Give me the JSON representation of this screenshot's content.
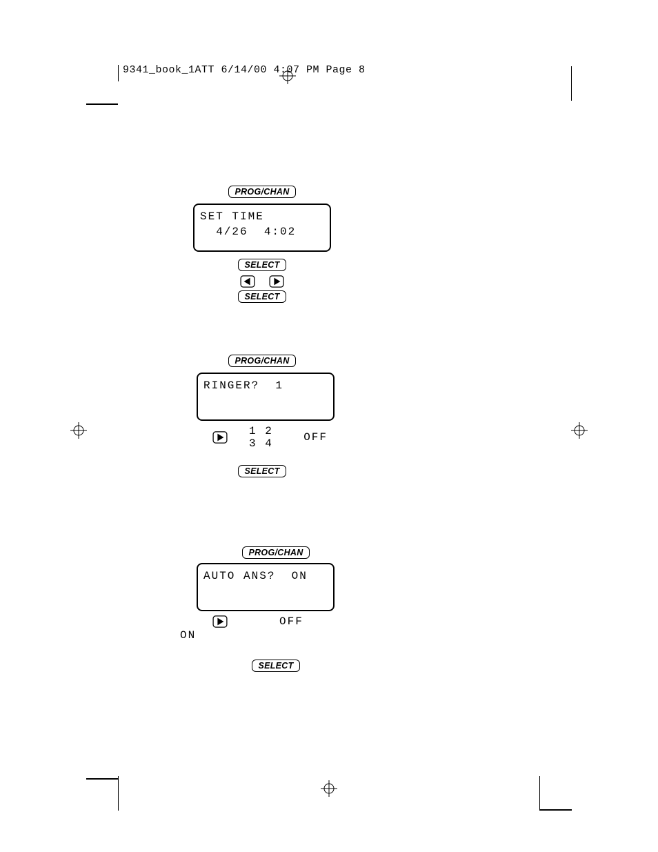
{
  "print_header": "9341_book_1ATT  6/14/00  4:07 PM  Page 8",
  "buttons": {
    "prog_chan": "PROG/CHAN",
    "select": "SELECT"
  },
  "block1": {
    "lcd_line1": "SET TIME",
    "lcd_line2": "  4/26  4:02"
  },
  "block2": {
    "lcd_line1": "RINGER?  1",
    "options": "1 2 3 4",
    "off": "OFF"
  },
  "block3": {
    "lcd_line1": "AUTO ANS?  ON",
    "off": "OFF",
    "on": "ON"
  }
}
